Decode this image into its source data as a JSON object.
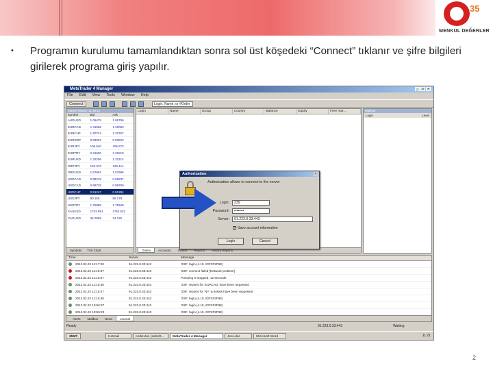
{
  "logo": {
    "number": "35",
    "name": "MENKUL DEĞERLER"
  },
  "slide": {
    "bullet": "•",
    "text": "Programın kurulumu tamamlandıktan sonra sol üst köşedeki “Connect” tıklanır ve şifre bilgileri girilerek programa giriş yapılır.",
    "page_number": "2"
  },
  "app": {
    "title": "MetaTrader 4 Manager",
    "window_buttons": [
      "_",
      "□",
      "×"
    ],
    "menu": [
      "File",
      "Edit",
      "View",
      "Tools",
      "Window",
      "Help"
    ],
    "toolbar": {
      "connect": "Connect",
      "search": "Login, Name, or #Order"
    },
    "market_watch": {
      "title": "Market Watch: 11:28:12",
      "columns": [
        "Symbol",
        "Bid",
        "Ask"
      ],
      "rows": [
        [
          "AUDUSD",
          "1.06475",
          "1.06796"
        ],
        [
          "EURCAD",
          "1.31968",
          "1.32093"
        ],
        [
          "EURCHF",
          "1.20724",
          "1.20767"
        ],
        [
          "EURGBP",
          "0.83603",
          "0.83623"
        ],
        [
          "EURJPY",
          "106.640",
          "106.673"
        ],
        [
          "EURTRY",
          "2.31650",
          "2.31810"
        ],
        [
          "EURUSD",
          "1.32206",
          "1.32214"
        ],
        [
          "GBPJPY",
          "126.376",
          "126.414"
        ],
        [
          "GBPUSD",
          "1.57682",
          "1.57696"
        ],
        [
          "USDCAD",
          "0.98219",
          "0.98237"
        ],
        [
          "USDCAD",
          "0.99729",
          "0.99769"
        ],
        [
          "USDCHF",
          "0.91247",
          "0.91284"
        ],
        [
          "USDJPY",
          "80.150",
          "80.178"
        ],
        [
          "USDTRY",
          "1.75888",
          "1.75949"
        ],
        [
          "XAUUSD",
          "1753.891",
          "1754.522"
        ],
        [
          "XAGUSD",
          "34.0099",
          "34.125"
        ]
      ],
      "selected_index": 11,
      "tabs": [
        "Symbols",
        "Tick Chart"
      ]
    },
    "grid": {
      "columns": [
        "Login",
        "Name",
        "Group",
        "Country",
        "Balance",
        "Equity",
        "Free mar..."
      ],
      "tabs": [
        "Online",
        "Accounts",
        "Orders",
        "Reports",
        "History Reports"
      ],
      "active_tab": "Online"
    },
    "mail_panel": {
      "title": "Mailbox",
      "columns": [
        "Login",
        "Level"
      ]
    },
    "journal": {
      "columns": [
        "Time",
        "Server",
        "Message"
      ],
      "rows": [
        [
          "2012.02.22 11:17:20",
          "91.223.0.33:443",
          "'239': login (4.10, #2F3F2F9E)",
          "ok"
        ],
        [
          "2012.02.22 11:16:57",
          "91.223.0.33:443",
          "'239': connect failed [Network problem]",
          "err"
        ],
        [
          "2012.02.22 11:16:57",
          "91.223.0.33:443",
          "Pumping is stopped, 12 seconds",
          "err"
        ],
        [
          "2012.02.22 11:16:36",
          "91.223.0.33:443",
          "'239': reports for 'EURCAD' have been requested",
          "ok"
        ],
        [
          "2012.02.22 11:15:47",
          "91.223.0.33:443",
          "'239': reports for 'NY' & tickets have been requested",
          "ok"
        ],
        [
          "2012.02.22 11:15:46",
          "91.223.0.33:443",
          "'239': login (4.10, #2F3F2F9E)",
          "ok"
        ],
        [
          "2012.02.22 10:56:37",
          "91.223.0.33:443",
          "'239': login (4.10, #2F3F2F9E)",
          "ok"
        ],
        [
          "2012.02.22 10:55:23",
          "91.223.0.33:443",
          "'239': login (4.10, #2F3F2F9E)",
          "ok"
        ]
      ],
      "tabs": [
        "Alerts",
        "Mailbox",
        "News",
        "Journal"
      ],
      "active_tab": "Journal"
    },
    "status": {
      "left": "Ready",
      "server": "91.223.0.33:443",
      "right": "Waiting"
    },
    "taskbar": {
      "start": "start",
      "items": [
        "Hotmail",
        "ozdvt.doc (salsoft...",
        "MetaTrader 4 Manager",
        "Jocx.doc",
        "Microsoft Word"
      ],
      "active_index": 2,
      "clock": "11:21"
    },
    "dialog": {
      "title": "Authorization",
      "close": "×",
      "message": "Authorization allows to connect to the server",
      "login_label": "Login:",
      "login_value": "239",
      "password_label": "Password:",
      "password_value": "••••••••",
      "server_label": "Server:",
      "server_value": "91.223.0.33:443",
      "checkbox": "Save account information",
      "login_button": "Login",
      "cancel_button": "Cancel"
    }
  },
  "colors": {
    "band": "#ee6a6a",
    "arrow": "#2452c4",
    "titlebar": "#0a246a"
  }
}
